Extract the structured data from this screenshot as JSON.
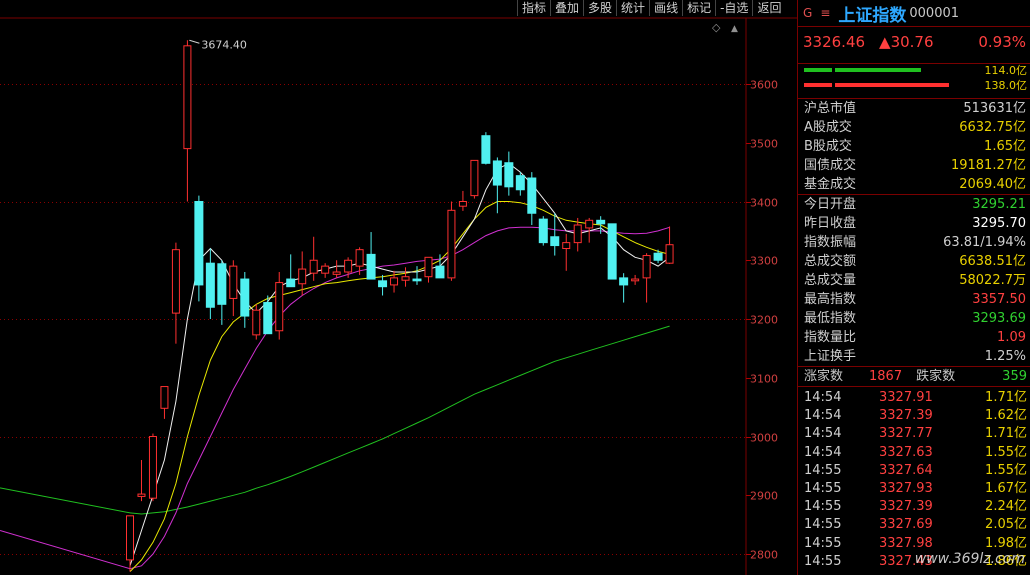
{
  "toolbar": [
    "指标",
    "叠加",
    "多股",
    "统计",
    "画线",
    "标记",
    "-自选",
    "返回"
  ],
  "panel": {
    "g_label": "G",
    "menu_glyph": "≡",
    "index_name": "上证指数",
    "index_code": "000001",
    "last": "3326.46",
    "change": "▲30.76",
    "change_pct": "0.93%",
    "bar1_label": "114.0亿",
    "bar2_label": "138.0亿",
    "group1": [
      {
        "k": "沪总市值",
        "v": "513631亿",
        "c": "#d0d0d0"
      },
      {
        "k": " A股成交",
        "v": "6632.75亿",
        "c": "#e8d000"
      },
      {
        "k": " B股成交",
        "v": "1.65亿",
        "c": "#e8d000"
      },
      {
        "k": "国债成交",
        "v": "19181.27亿",
        "c": "#e8d000"
      },
      {
        "k": "基金成交",
        "v": "2069.40亿",
        "c": "#e8d000"
      }
    ],
    "group2": [
      {
        "k": "今日开盘",
        "v": "3295.21",
        "c": "#30d030"
      },
      {
        "k": "昨日收盘",
        "v": "3295.70",
        "c": "#ffffff"
      },
      {
        "k": "指数振幅",
        "v": "63.81/1.94%",
        "c": "#d0d0d0"
      },
      {
        "k": "总成交额",
        "v": "6638.51亿",
        "c": "#e8d000"
      },
      {
        "k": "总成交量",
        "v": "58022.7万",
        "c": "#e8d000"
      },
      {
        "k": "最高指数",
        "v": "3357.50",
        "c": "#ff4040"
      },
      {
        "k": "最低指数",
        "v": "3293.69",
        "c": "#30d030"
      },
      {
        "k": "指数量比",
        "v": "1.09",
        "c": "#ff4040"
      },
      {
        "k": "上证换手",
        "v": "1.25%",
        "c": "#d0d0d0"
      }
    ],
    "advance_label": "涨家数",
    "advance": "1867",
    "decline_label": "跌家数",
    "decline": "359",
    "ticks": [
      {
        "t": "14:54",
        "p": "3327.91",
        "v": "1.71亿"
      },
      {
        "t": "14:54",
        "p": "3327.39",
        "v": "1.62亿"
      },
      {
        "t": "14:54",
        "p": "3327.77",
        "v": "1.71亿"
      },
      {
        "t": "14:54",
        "p": "3327.63",
        "v": "1.55亿"
      },
      {
        "t": "14:55",
        "p": "3327.64",
        "v": "1.55亿"
      },
      {
        "t": "14:55",
        "p": "3327.93",
        "v": "1.67亿"
      },
      {
        "t": "14:55",
        "p": "3327.39",
        "v": "2.24亿"
      },
      {
        "t": "14:55",
        "p": "3327.69",
        "v": "2.05亿"
      },
      {
        "t": "14:55",
        "p": "3327.98",
        "v": "1.98亿"
      },
      {
        "t": "14:55",
        "p": "3327.43",
        "v": "1.86亿"
      }
    ],
    "watermark": "www.369lz.com"
  },
  "chart_data": {
    "type": "candlestick",
    "yticks": [
      2800,
      2900,
      3000,
      3100,
      3200,
      3300,
      3400,
      3500,
      3600
    ],
    "ylim": [
      2770,
      3700
    ],
    "peak_label": "3674.40",
    "up_color": "#ff3030",
    "down_color": "#50f0f0",
    "candles": [
      {
        "o": 2790,
        "h": 2840,
        "l": 2770,
        "c": 2865
      },
      {
        "o": 2898,
        "h": 2960,
        "l": 2890,
        "c": 2902
      },
      {
        "o": 2895,
        "h": 3005,
        "l": 2890,
        "c": 3000
      },
      {
        "o": 3048,
        "h": 3085,
        "l": 3030,
        "c": 3085
      },
      {
        "o": 3210,
        "h": 3330,
        "l": 3158,
        "c": 3318
      },
      {
        "o": 3490,
        "h": 3674.4,
        "l": 3400,
        "c": 3665
      },
      {
        "o": 3400,
        "h": 3410,
        "l": 3230,
        "c": 3258
      },
      {
        "o": 3295,
        "h": 3320,
        "l": 3200,
        "c": 3220
      },
      {
        "o": 3294,
        "h": 3300,
        "l": 3190,
        "c": 3225
      },
      {
        "o": 3235,
        "h": 3300,
        "l": 3205,
        "c": 3290
      },
      {
        "o": 3268,
        "h": 3280,
        "l": 3185,
        "c": 3205
      },
      {
        "o": 3173,
        "h": 3225,
        "l": 3165,
        "c": 3215
      },
      {
        "o": 3228,
        "h": 3240,
        "l": 3180,
        "c": 3175
      },
      {
        "o": 3180,
        "h": 3280,
        "l": 3165,
        "c": 3262
      },
      {
        "o": 3268,
        "h": 3310,
        "l": 3255,
        "c": 3255
      },
      {
        "o": 3260,
        "h": 3315,
        "l": 3240,
        "c": 3285
      },
      {
        "o": 3278,
        "h": 3340,
        "l": 3265,
        "c": 3300
      },
      {
        "o": 3278,
        "h": 3295,
        "l": 3270,
        "c": 3290
      },
      {
        "o": 3276,
        "h": 3300,
        "l": 3270,
        "c": 3280
      },
      {
        "o": 3280,
        "h": 3305,
        "l": 3270,
        "c": 3300
      },
      {
        "o": 3290,
        "h": 3322,
        "l": 3275,
        "c": 3318
      },
      {
        "o": 3310,
        "h": 3348,
        "l": 3295,
        "c": 3268
      },
      {
        "o": 3265,
        "h": 3275,
        "l": 3240,
        "c": 3255
      },
      {
        "o": 3258,
        "h": 3282,
        "l": 3245,
        "c": 3270
      },
      {
        "o": 3266,
        "h": 3288,
        "l": 3255,
        "c": 3272
      },
      {
        "o": 3268,
        "h": 3290,
        "l": 3258,
        "c": 3265
      },
      {
        "o": 3272,
        "h": 3296,
        "l": 3262,
        "c": 3305
      },
      {
        "o": 3290,
        "h": 3310,
        "l": 3278,
        "c": 3270
      },
      {
        "o": 3270,
        "h": 3400,
        "l": 3265,
        "c": 3385
      },
      {
        "o": 3392,
        "h": 3418,
        "l": 3384,
        "c": 3400
      },
      {
        "o": 3410,
        "h": 3465,
        "l": 3405,
        "c": 3470
      },
      {
        "o": 3512,
        "h": 3518,
        "l": 3463,
        "c": 3465
      },
      {
        "o": 3469,
        "h": 3475,
        "l": 3380,
        "c": 3428
      },
      {
        "o": 3466,
        "h": 3485,
        "l": 3410,
        "c": 3425
      },
      {
        "o": 3444,
        "h": 3450,
        "l": 3410,
        "c": 3420
      },
      {
        "o": 3440,
        "h": 3450,
        "l": 3360,
        "c": 3380
      },
      {
        "o": 3370,
        "h": 3375,
        "l": 3325,
        "c": 3330
      },
      {
        "o": 3340,
        "h": 3380,
        "l": 3308,
        "c": 3325
      },
      {
        "o": 3320,
        "h": 3345,
        "l": 3282,
        "c": 3330
      },
      {
        "o": 3330,
        "h": 3372,
        "l": 3315,
        "c": 3360
      },
      {
        "o": 3355,
        "h": 3372,
        "l": 3330,
        "c": 3368
      },
      {
        "o": 3368,
        "h": 3375,
        "l": 3345,
        "c": 3362
      },
      {
        "o": 3362,
        "h": 3362,
        "l": 3300,
        "c": 3268
      },
      {
        "o": 3270,
        "h": 3278,
        "l": 3228,
        "c": 3258
      },
      {
        "o": 3265,
        "h": 3275,
        "l": 3258,
        "c": 3268
      },
      {
        "o": 3270,
        "h": 3312,
        "l": 3228,
        "c": 3308
      },
      {
        "o": 3312,
        "h": 3318,
        "l": 3295,
        "c": 3300
      },
      {
        "o": 3295,
        "h": 3357.5,
        "l": 3293.69,
        "c": 3326.46
      }
    ],
    "ma_white": [
      2780,
      2840,
      2900,
      2960,
      3060,
      3200,
      3300,
      3320,
      3300,
      3260,
      3230,
      3210,
      3230,
      3255,
      3265,
      3270,
      3280,
      3285,
      3290,
      3290,
      3295,
      3290,
      3285,
      3280,
      3280,
      3280,
      3285,
      3290,
      3310,
      3340,
      3370,
      3420,
      3455,
      3465,
      3450,
      3430,
      3405,
      3380,
      3350,
      3345,
      3350,
      3355,
      3340,
      3318,
      3305,
      3300,
      3290,
      3305
    ],
    "ma_yellow": [
      2770,
      2790,
      2820,
      2860,
      2920,
      3000,
      3070,
      3130,
      3170,
      3195,
      3210,
      3225,
      3235,
      3240,
      3245,
      3250,
      3255,
      3260,
      3262,
      3265,
      3268,
      3270,
      3272,
      3275,
      3278,
      3282,
      3290,
      3300,
      3320,
      3345,
      3370,
      3390,
      3400,
      3400,
      3398,
      3393,
      3385,
      3375,
      3368,
      3365,
      3362,
      3360,
      3350,
      3340,
      3330,
      3322,
      3315,
      3310
    ],
    "ma_magenta": [
      2775,
      2780,
      2800,
      2830,
      2870,
      2920,
      2960,
      3000,
      3040,
      3080,
      3115,
      3150,
      3180,
      3205,
      3225,
      3240,
      3252,
      3262,
      3270,
      3276,
      3282,
      3286,
      3290,
      3292,
      3295,
      3298,
      3300,
      3302,
      3308,
      3318,
      3330,
      3342,
      3350,
      3355,
      3356,
      3356,
      3355,
      3352,
      3350,
      3350,
      3350,
      3350,
      3348,
      3346,
      3345,
      3346,
      3350,
      3356
    ],
    "ma_green": [
      2870,
      2868,
      2870,
      2872,
      2876,
      2880,
      2885,
      2890,
      2895,
      2900,
      2905,
      2912,
      2918,
      2925,
      2932,
      2940,
      2948,
      2956,
      2964,
      2972,
      2980,
      2988,
      2996,
      3005,
      3014,
      3023,
      3032,
      3042,
      3052,
      3062,
      3072,
      3080,
      3088,
      3096,
      3104,
      3112,
      3120,
      3128,
      3134,
      3140,
      3146,
      3152,
      3158,
      3164,
      3170,
      3176,
      3182,
      3188
    ]
  }
}
